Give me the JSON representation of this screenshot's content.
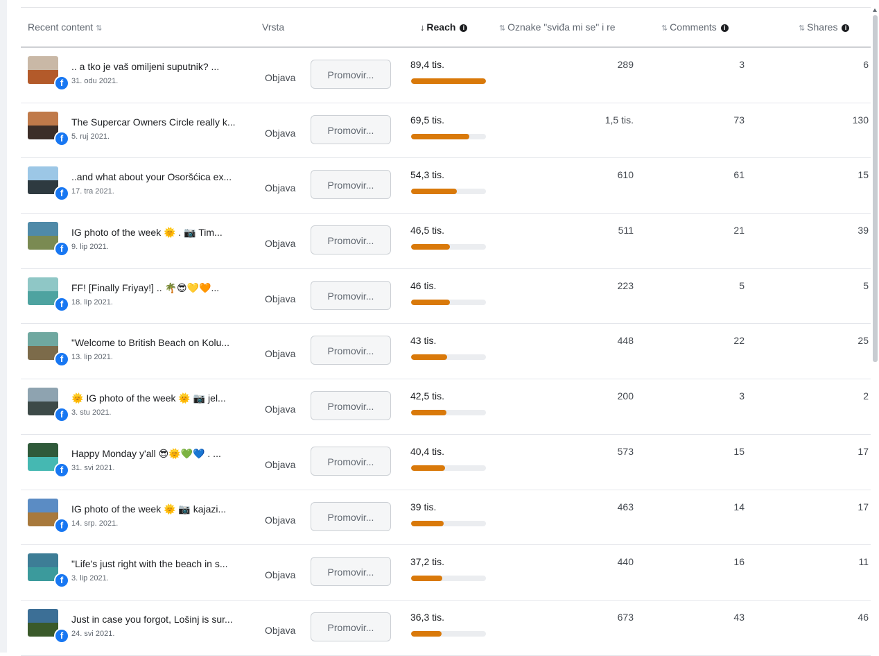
{
  "header": {
    "content": "Recent content",
    "type": "Vrsta",
    "reach": "Reach",
    "likes": "Oznake \"sviđa mi se\" i re",
    "comments": "Comments",
    "shares": "Shares",
    "sort_glyph": "⇅",
    "sort_down_glyph": "↓"
  },
  "rows": [
    {
      "title": ".. a tko je vaš omiljeni suputnik? ...",
      "date": "31. odu 2021.",
      "type": "Objava",
      "promote": "Promovir...",
      "reach": "89,4 tis.",
      "reach_value": 89.4,
      "likes": "289",
      "comments": "3",
      "shares": "6",
      "thumb": [
        "#c9b8a6",
        "#b35a2a"
      ]
    },
    {
      "title": "The Supercar Owners Circle really k...",
      "date": "5. ruj 2021.",
      "type": "Objava",
      "promote": "Promovir...",
      "reach": "69,5 tis.",
      "reach_value": 69.5,
      "likes": "1,5 tis.",
      "comments": "73",
      "shares": "130",
      "thumb": [
        "#c07a4a",
        "#3c2e28"
      ]
    },
    {
      "title": "..and what about your Osoršćica ex...",
      "date": "17. tra 2021.",
      "type": "Objava",
      "promote": "Promovir...",
      "reach": "54,3 tis.",
      "reach_value": 54.3,
      "likes": "610",
      "comments": "61",
      "shares": "15",
      "thumb": [
        "#9cc7e6",
        "#2e3a40"
      ]
    },
    {
      "title": "IG photo of the week 🌞 . 📷 Tim...",
      "date": "9. lip 2021.",
      "type": "Objava",
      "promote": "Promovir...",
      "reach": "46,5 tis.",
      "reach_value": 46.5,
      "likes": "511",
      "comments": "21",
      "shares": "39",
      "thumb": [
        "#4f8aa8",
        "#7a8a52"
      ]
    },
    {
      "title": "FF! [Finally Friyay!] .. 🌴😎💛🧡...",
      "date": "18. lip 2021.",
      "type": "Objava",
      "promote": "Promovir...",
      "reach": "46 tis.",
      "reach_value": 46,
      "likes": "223",
      "comments": "5",
      "shares": "5",
      "thumb": [
        "#8fc7c6",
        "#4ea3a0"
      ]
    },
    {
      "title": "\"Welcome to British Beach on Kolu...",
      "date": "13. lip 2021.",
      "type": "Objava",
      "promote": "Promovir...",
      "reach": "43 tis.",
      "reach_value": 43,
      "likes": "448",
      "comments": "22",
      "shares": "25",
      "thumb": [
        "#6fa8a0",
        "#7c6b4a"
      ]
    },
    {
      "title": "🌞 IG photo of the week 🌞 📷 jel...",
      "date": "3. stu 2021.",
      "type": "Objava",
      "promote": "Promovir...",
      "reach": "42,5 tis.",
      "reach_value": 42.5,
      "likes": "200",
      "comments": "3",
      "shares": "2",
      "thumb": [
        "#8ea3b0",
        "#3d4a48"
      ]
    },
    {
      "title": "Happy Monday y'all 😎🌞💚💙 . ...",
      "date": "31. svi 2021.",
      "type": "Objava",
      "promote": "Promovir...",
      "reach": "40,4 tis.",
      "reach_value": 40.4,
      "likes": "573",
      "comments": "15",
      "shares": "17",
      "thumb": [
        "#2f5a3a",
        "#45b8b2"
      ]
    },
    {
      "title": "IG photo of the week 🌞 📷 kajazi...",
      "date": "14. srp. 2021.",
      "type": "Objava",
      "promote": "Promovir...",
      "reach": "39 tis.",
      "reach_value": 39,
      "likes": "463",
      "comments": "14",
      "shares": "17",
      "thumb": [
        "#5b8cc4",
        "#a8793c"
      ]
    },
    {
      "title": "\"Life's just right with the beach in s...",
      "date": "3. lip 2021.",
      "type": "Objava",
      "promote": "Promovir...",
      "reach": "37,2 tis.",
      "reach_value": 37.2,
      "likes": "440",
      "comments": "16",
      "shares": "11",
      "thumb": [
        "#3d7d96",
        "#3b9a9c"
      ]
    },
    {
      "title": "Just in case you forgot, Lošinj is sur...",
      "date": "24. svi 2021.",
      "type": "Objava",
      "promote": "Promovir...",
      "reach": "36,3 tis.",
      "reach_value": 36.3,
      "likes": "673",
      "comments": "43",
      "shares": "46",
      "thumb": [
        "#3c6f96",
        "#3a5a2a"
      ]
    }
  ],
  "reach_max": 89.4,
  "colors": {
    "bar": "#d9790a",
    "fb": "#1877f2"
  }
}
